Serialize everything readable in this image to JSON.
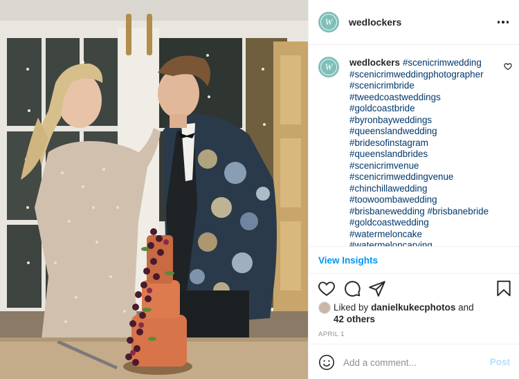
{
  "post": {
    "username": "wedlockers",
    "avatar_letter": "W",
    "more_icon": "more-horizontal-icon",
    "caption_hashtags": [
      "#scenicrimwedding",
      "#scenicrimweddingphotographer",
      "#scenicrimbride",
      "#tweedcoastweddings",
      "#goldcoastbride",
      "#byronbayweddings",
      "#queenslandwedding",
      "#bridesofinstagram",
      "#queenslandbrides",
      "#scenicrimvenue",
      "#scenicrimweddingvenue",
      "#chinchillawedding",
      "#toowoombawedding",
      "#brisbanewedding",
      "#brisbanebride",
      "#goldcoastwedding",
      "#watermeloncake",
      "#watermeloncarving"
    ],
    "view_insights_label": "View Insights",
    "likes": {
      "prefix": "Liked by",
      "user": "danielkukecphotos",
      "and": "and",
      "others": "42 others"
    },
    "date": "APRIL 1",
    "comment": {
      "placeholder": "Add a comment...",
      "post_label": "Post"
    }
  },
  "colors": {
    "link": "#00376b",
    "accent": "#0095f6",
    "post_disabled": "#b2dffc",
    "avatar_bg": "#7fbfb8"
  }
}
